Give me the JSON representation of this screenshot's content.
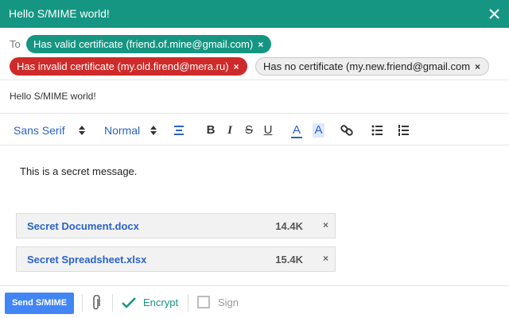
{
  "window": {
    "title": "Hello S/MIME world!",
    "accent": "#159683"
  },
  "recipients": {
    "to_label": "To",
    "chips": [
      {
        "label": "Has valid certificate (friend.of.mine@gmail.com)",
        "status": "valid",
        "color": "#159683",
        "remove": "×"
      },
      {
        "label": "Has invalid certificate (my.old.firend@mera.ru)",
        "status": "invalid",
        "color": "#cf2a2a",
        "remove": "×"
      },
      {
        "label": "Has no certificate (my.new.friend@gmail.com",
        "status": "none",
        "color": "#eeeeee",
        "remove": "×"
      }
    ]
  },
  "subject": "Hello S/MIME world!",
  "toolbar": {
    "font": "Sans Serif",
    "size": "Normal",
    "icons": [
      "align-icon",
      "bold-icon",
      "italic-icon",
      "strikethrough-icon",
      "underline-icon",
      "text-color-icon",
      "highlight-icon",
      "link-icon",
      "bulleted-list-icon",
      "numbered-list-icon"
    ],
    "bold": "B",
    "italic": "I",
    "strike": "S",
    "underline": "U",
    "text_color": "A",
    "highlight": "A"
  },
  "message": "This is a secret message.",
  "attachments": [
    {
      "name": "Secret Document.docx",
      "size": "14.4K",
      "remove": "×"
    },
    {
      "name": "Secret Spreadsheet.xlsx",
      "size": "15.4K",
      "remove": "×"
    }
  ],
  "footer": {
    "send_label": "Send S/MIME",
    "encrypt_label": "Encrypt",
    "encrypt_checked": true,
    "sign_label": "Sign",
    "sign_checked": false
  }
}
